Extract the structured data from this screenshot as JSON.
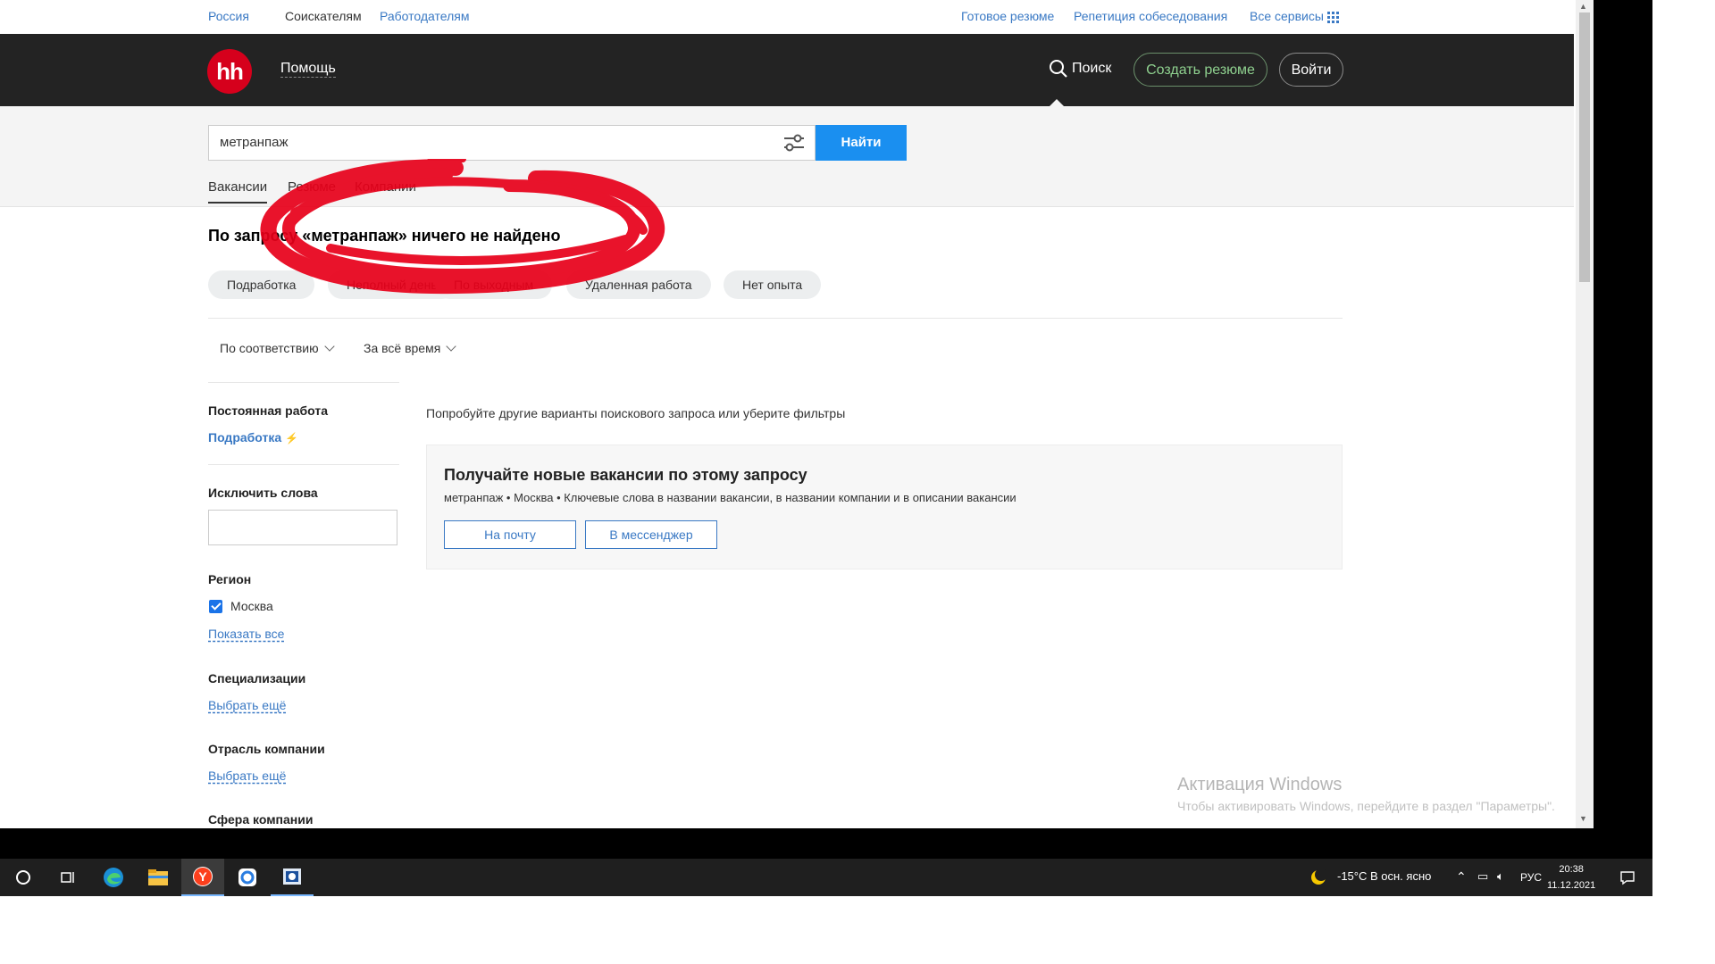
{
  "topnav": {
    "region": "Россия",
    "seekers": "Соискателям",
    "employers": "Работодателям",
    "ready_resume": "Готовое резюме",
    "interview_rehearsal": "Репетиция собеседования",
    "all_services": "Все сервисы"
  },
  "header": {
    "logo": "hh",
    "help": "Помощь",
    "search": "Поиск",
    "create_resume": "Создать резюме",
    "login": "Войти"
  },
  "search": {
    "value": "метранпаж",
    "button": "Найти"
  },
  "tabs": [
    "Вакансии",
    "Резюме",
    "Компании"
  ],
  "results": {
    "no_result": "По запросу «метранпаж» ничего не найдено",
    "chips": [
      "Подработка",
      "Неполный день",
      "По выходным",
      "Удаленная работа",
      "Нет опыта"
    ],
    "sort": "По соответствию",
    "period": "За всё время",
    "hint": "Попробуйте другие варианты поискового запроса или уберите фильтры"
  },
  "sidebar": {
    "employment_header": "Постоянная работа",
    "parttime_link": "Подработка",
    "exclude_header": "Исключить слова",
    "region_header": "Регион",
    "region_item": "Москва",
    "region_show_all": "Показать все",
    "spec_header": "Специализации",
    "spec_more": "Выбрать ещё",
    "industry_header": "Отрасль компании",
    "industry_more": "Выбрать ещё",
    "sphere_header": "Сфера компании"
  },
  "subscription": {
    "title": "Получайте новые вакансии по этому запросу",
    "desc": "метранпаж • Москва • Ключевые слова в названии вакансии, в названии компании и в описании вакансии",
    "email_btn": "На почту",
    "messenger_btn": "В мессенджер"
  },
  "watermark": {
    "title": "Активация Windows",
    "subtitle": "Чтобы активировать Windows, перейдите в раздел \"Параметры\"."
  },
  "taskbar": {
    "weather": "-15°C  В осн. ясно",
    "lang": "РУС",
    "time": "20:38",
    "date": "11.12.2021"
  },
  "colors": {
    "brand_red": "#d6001c",
    "header_bg": "#232323",
    "primary_blue": "#1a8ff0",
    "link_blue": "#3a79c4",
    "annotation_red": "#e8001a"
  },
  "icons": [
    "search-icon",
    "filters-icon",
    "lightning-icon",
    "checkbox-checked-icon",
    "start-icon",
    "task-view-icon",
    "edge-icon",
    "explorer-icon",
    "yandex-icon",
    "app-icon",
    "weather-icon",
    "notification-icon"
  ]
}
